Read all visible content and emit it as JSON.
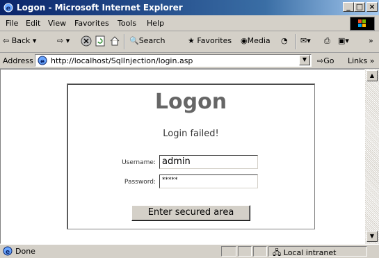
{
  "window": {
    "title": "Logon - Microsoft Internet Explorer"
  },
  "menu": [
    "File",
    "Edit",
    "View",
    "Favorites",
    "Tools",
    "Help"
  ],
  "toolbar": {
    "back": "Back",
    "search": "Search",
    "favorites": "Favorites",
    "media": "Media"
  },
  "address": {
    "label": "Address",
    "url": "http://localhost/SqlInjection/login.asp",
    "go": "Go",
    "links": "Links"
  },
  "page": {
    "title": "Logon",
    "message": "Login failed!",
    "username_label": "Username:",
    "username_value": "admin",
    "password_label": "Password:",
    "password_value": "*****",
    "submit_label": "Enter secured area"
  },
  "status": {
    "text": "Done",
    "zone": "Local intranet"
  }
}
